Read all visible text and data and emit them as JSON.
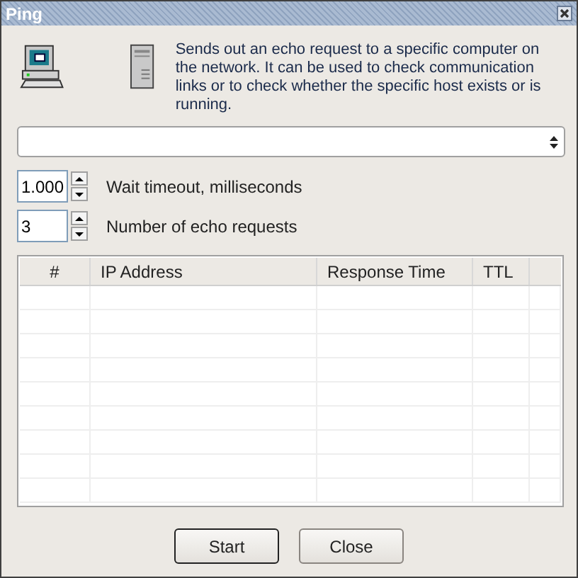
{
  "window": {
    "title": "Ping"
  },
  "description": "Sends out an echo request to a specific computer on the network. It can be used to check communication links or to check whether the specific host exists or is running.",
  "spinners": [
    {
      "value": "1.000",
      "label": "Wait timeout, milliseconds"
    },
    {
      "value": "3",
      "label": "Number of echo requests"
    }
  ],
  "table": {
    "columns": [
      "#",
      "IP Address",
      "Response Time",
      "TTL"
    ]
  },
  "buttons": [
    {
      "label": "Start",
      "default": true
    },
    {
      "label": "Close",
      "default": false
    }
  ]
}
